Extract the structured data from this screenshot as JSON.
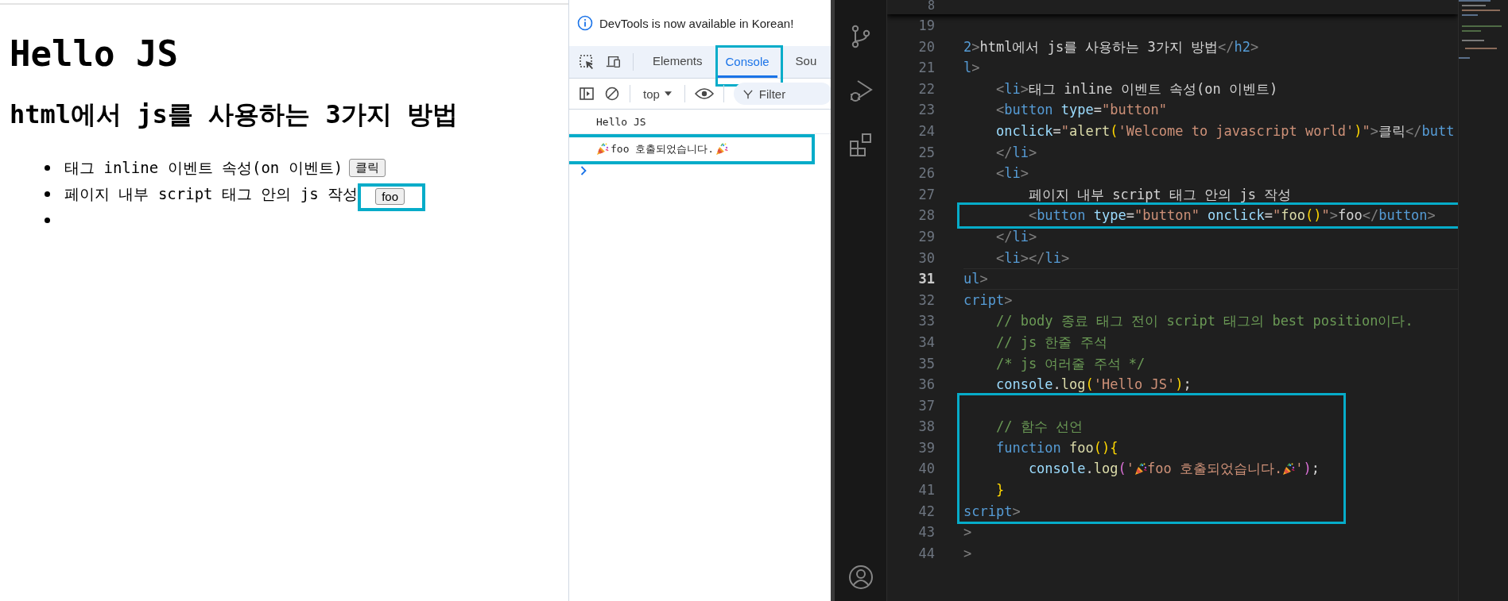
{
  "browser_page": {
    "heading": "Hello JS",
    "subheading": "html에서 js를 사용하는 3가지 방법",
    "items": [
      {
        "kind": "button-item",
        "text": "태그 inline 이벤트 속성(on 이벤트)",
        "button": "클릭",
        "framed": false
      },
      {
        "kind": "button-item",
        "text": "페이지 내부 script 태그 안의 js 작성",
        "button": "foo",
        "framed": true
      },
      {
        "kind": "empty"
      }
    ]
  },
  "devtools": {
    "banner": "DevTools is now available in Korean!",
    "tabs": [
      {
        "label": "Elements",
        "selected": false,
        "framed": false
      },
      {
        "label": "Console",
        "selected": true,
        "framed": true
      },
      {
        "label": "Sou",
        "selected": false,
        "framed": false
      }
    ],
    "context": "top",
    "filter": {
      "placeholder": "Filter"
    },
    "messages": [
      {
        "framed": false,
        "parts": [
          {
            "kind": "text",
            "text": "Hello JS"
          }
        ]
      },
      {
        "framed": true,
        "parts": [
          {
            "kind": "emoji"
          },
          {
            "kind": "text",
            "text": "foo 호출되었습니다."
          },
          {
            "kind": "emoji"
          }
        ]
      }
    ]
  },
  "editor": {
    "sticky_line": "8",
    "lines": [
      {
        "number": "19",
        "current": false,
        "framed": false,
        "kind": "flush"
      },
      {
        "number": "20",
        "current": false,
        "framed": false,
        "kind": "flush",
        "tokens": [
          {
            "kind": "tag",
            "text": "2"
          },
          {
            "kind": "punct",
            "text": ">"
          },
          {
            "kind": "text",
            "text": "html에서 js를 사용하는 3가지 방법"
          },
          {
            "kind": "punct",
            "text": "</"
          },
          {
            "kind": "tag",
            "text": "h2"
          },
          {
            "kind": "punct",
            "text": ">"
          }
        ]
      },
      {
        "number": "21",
        "current": false,
        "framed": false,
        "kind": "flush",
        "tokens": [
          {
            "kind": "tag",
            "text": "l"
          },
          {
            "kind": "punct",
            "text": ">"
          }
        ]
      },
      {
        "number": "22",
        "current": false,
        "framed": false,
        "kind": "indented",
        "tokens": [
          {
            "kind": "punct",
            "text": "<"
          },
          {
            "kind": "tag",
            "text": "li"
          },
          {
            "kind": "punct",
            "text": ">"
          },
          {
            "kind": "text",
            "text": "태그 inline 이벤트 속성(on 이벤트)"
          }
        ]
      },
      {
        "number": "23",
        "current": false,
        "framed": false,
        "kind": "indented",
        "tokens": [
          {
            "kind": "punct",
            "text": "<"
          },
          {
            "kind": "tag",
            "text": "button"
          },
          {
            "kind": "attr",
            "text": " type"
          },
          {
            "kind": "text",
            "text": "="
          },
          {
            "kind": "str",
            "text": "\"button\""
          }
        ]
      },
      {
        "number": "24",
        "current": false,
        "framed": false,
        "kind": "indented",
        "tokens": [
          {
            "kind": "attr",
            "text": "onclick"
          },
          {
            "kind": "text",
            "text": "="
          },
          {
            "kind": "str",
            "text": "\""
          },
          {
            "kind": "func",
            "text": "alert"
          },
          {
            "kind": "br1",
            "text": "("
          },
          {
            "kind": "str",
            "text": "'Welcome to javascript world'"
          },
          {
            "kind": "br1",
            "text": ")"
          },
          {
            "kind": "str",
            "text": "\""
          },
          {
            "kind": "punct",
            "text": ">"
          },
          {
            "kind": "text",
            "text": "클릭"
          },
          {
            "kind": "punct",
            "text": "</"
          },
          {
            "kind": "tag",
            "text": "butt"
          }
        ]
      },
      {
        "number": "25",
        "current": false,
        "framed": false,
        "kind": "indented",
        "tokens": [
          {
            "kind": "punct",
            "text": "</"
          },
          {
            "kind": "tag",
            "text": "li"
          },
          {
            "kind": "punct",
            "text": ">"
          }
        ]
      },
      {
        "number": "26",
        "current": false,
        "framed": false,
        "kind": "indented",
        "tokens": [
          {
            "kind": "punct",
            "text": "<"
          },
          {
            "kind": "tag",
            "text": "li"
          },
          {
            "kind": "punct",
            "text": ">"
          }
        ]
      },
      {
        "number": "27",
        "current": false,
        "framed": false,
        "kind": "nested",
        "tokens": [
          {
            "kind": "text",
            "text": "페이지 내부 script 태그 안의 js 작성"
          }
        ]
      },
      {
        "number": "28",
        "current": false,
        "framed": true,
        "kind": "nested",
        "tokens": [
          {
            "kind": "punct",
            "text": "<"
          },
          {
            "kind": "tag",
            "text": "button"
          },
          {
            "kind": "attr",
            "text": " type"
          },
          {
            "kind": "text",
            "text": "="
          },
          {
            "kind": "str",
            "text": "\"button\""
          },
          {
            "kind": "attr",
            "text": " onclick"
          },
          {
            "kind": "text",
            "text": "="
          },
          {
            "kind": "str",
            "text": "\""
          },
          {
            "kind": "func",
            "text": "foo"
          },
          {
            "kind": "br1",
            "text": "()"
          },
          {
            "kind": "str",
            "text": "\""
          },
          {
            "kind": "punct",
            "text": ">"
          },
          {
            "kind": "text",
            "text": "foo"
          },
          {
            "kind": "punct",
            "text": "</"
          },
          {
            "kind": "tag",
            "text": "button"
          },
          {
            "kind": "punct",
            "text": ">"
          }
        ]
      },
      {
        "number": "29",
        "current": false,
        "framed": false,
        "kind": "indented",
        "tokens": [
          {
            "kind": "punct",
            "text": "</"
          },
          {
            "kind": "tag",
            "text": "li"
          },
          {
            "kind": "punct",
            "text": ">"
          }
        ]
      },
      {
        "number": "30",
        "current": false,
        "framed": false,
        "kind": "indented",
        "tokens": [
          {
            "kind": "punct",
            "text": "<"
          },
          {
            "kind": "tag",
            "text": "li"
          },
          {
            "kind": "punct",
            "text": "></"
          },
          {
            "kind": "tag",
            "text": "li"
          },
          {
            "kind": "punct",
            "text": ">"
          }
        ]
      },
      {
        "number": "31",
        "current": true,
        "framed": false,
        "kind": "flush",
        "tokens": [
          {
            "kind": "tag",
            "text": "ul"
          },
          {
            "kind": "punct",
            "text": ">"
          }
        ]
      },
      {
        "number": "32",
        "current": false,
        "framed": false,
        "kind": "flush",
        "tokens": [
          {
            "kind": "tag",
            "text": "cript"
          },
          {
            "kind": "punct",
            "text": ">"
          }
        ]
      },
      {
        "number": "33",
        "current": false,
        "framed": false,
        "kind": "indented",
        "tokens": [
          {
            "kind": "comment",
            "text": "// body 종료 태그 전이 script 태그의 best position이다."
          }
        ]
      },
      {
        "number": "34",
        "current": false,
        "framed": false,
        "kind": "indented",
        "tokens": [
          {
            "kind": "comment",
            "text": "// js 한줄 주석"
          }
        ]
      },
      {
        "number": "35",
        "current": false,
        "framed": false,
        "kind": "indented",
        "tokens": [
          {
            "kind": "comment",
            "text": "/* js 여러줄 주석 */"
          }
        ]
      },
      {
        "number": "36",
        "current": false,
        "framed": false,
        "kind": "indented",
        "tokens": [
          {
            "kind": "var",
            "text": "console"
          },
          {
            "kind": "text",
            "text": "."
          },
          {
            "kind": "func",
            "text": "log"
          },
          {
            "kind": "br1",
            "text": "("
          },
          {
            "kind": "str",
            "text": "'Hello JS'"
          },
          {
            "kind": "br1",
            "text": ")"
          },
          {
            "kind": "text",
            "text": ";"
          }
        ]
      },
      {
        "number": "37",
        "current": false,
        "framed": true,
        "kind": "flush"
      },
      {
        "number": "38",
        "current": false,
        "framed": true,
        "kind": "indented",
        "tokens": [
          {
            "kind": "comment",
            "text": "// 함수 선언"
          }
        ]
      },
      {
        "number": "39",
        "current": false,
        "framed": true,
        "kind": "indented",
        "tokens": [
          {
            "kind": "kw",
            "text": "function"
          },
          {
            "kind": "func",
            "text": " foo"
          },
          {
            "kind": "br1",
            "text": "(){"
          }
        ]
      },
      {
        "number": "40",
        "current": false,
        "framed": true,
        "kind": "nested",
        "tokens": [
          {
            "kind": "var",
            "text": "console"
          },
          {
            "kind": "text",
            "text": "."
          },
          {
            "kind": "func",
            "text": "log"
          },
          {
            "kind": "br2",
            "text": "("
          },
          {
            "kind": "str",
            "text": "'"
          },
          {
            "kind": "emoji"
          },
          {
            "kind": "str",
            "text": "foo 호출되었습니다."
          },
          {
            "kind": "emoji"
          },
          {
            "kind": "str",
            "text": "'"
          },
          {
            "kind": "br2",
            "text": ")"
          },
          {
            "kind": "text",
            "text": ";"
          }
        ]
      },
      {
        "number": "41",
        "current": false,
        "framed": true,
        "kind": "indented",
        "tokens": [
          {
            "kind": "br1",
            "text": "}"
          }
        ]
      },
      {
        "number": "42",
        "current": false,
        "framed": true,
        "kind": "flush",
        "tokens": [
          {
            "kind": "tag",
            "text": "script"
          },
          {
            "kind": "punct",
            "text": ">"
          }
        ]
      },
      {
        "number": "43",
        "current": false,
        "framed": false,
        "kind": "flush",
        "tokens": [
          {
            "kind": "punct",
            "text": ">"
          }
        ]
      },
      {
        "number": "44",
        "current": false,
        "framed": false,
        "kind": "flush",
        "tokens": [
          {
            "kind": "punct",
            "text": ">"
          }
        ]
      }
    ]
  }
}
